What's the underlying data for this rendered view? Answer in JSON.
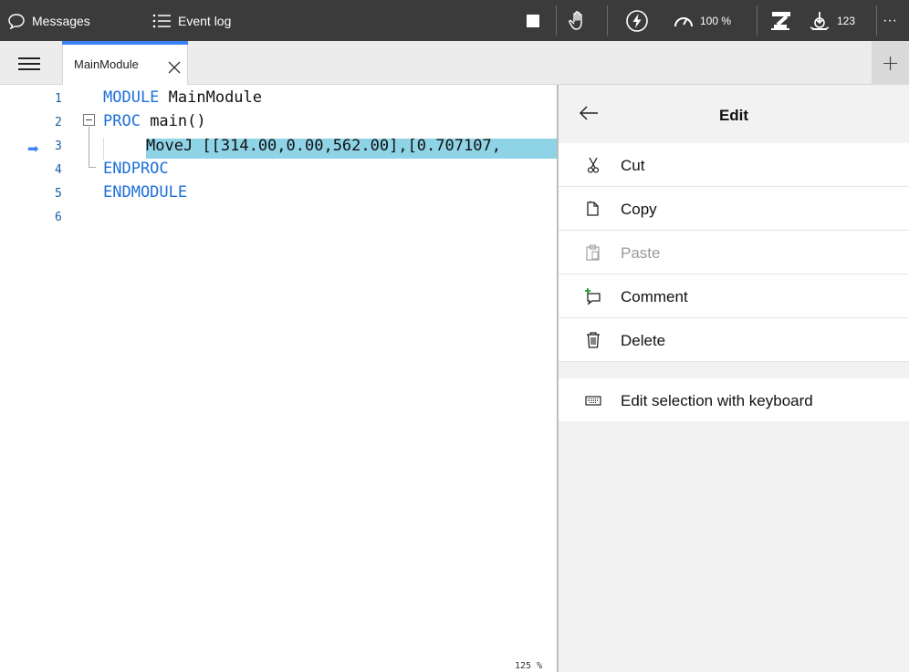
{
  "topbar": {
    "messages_label": "Messages",
    "eventlog_label": "Event log",
    "speed_label": "100 %",
    "count_label": "123",
    "more_label": "···"
  },
  "tabs": {
    "active_file": "MainModule",
    "add_label": "+"
  },
  "editor": {
    "line_numbers": [
      "1",
      "2",
      "3",
      "4",
      "5",
      "6"
    ],
    "line1_kw": "MODULE",
    "line1_name": " MainModule",
    "line2_kw": "PROC",
    "line2_rest": " main()",
    "line3_code": "MoveJ [[314.00,0.00,562.00],[0.707107,",
    "line4_kw": "ENDPROC",
    "line5_kw": "ENDMODULE",
    "zoom": "125 %",
    "pc_arrow": "➡"
  },
  "panel": {
    "title": "Edit",
    "items": [
      {
        "label": "Cut",
        "icon": "scissors-icon",
        "enabled": true
      },
      {
        "label": "Copy",
        "icon": "copy-icon",
        "enabled": true
      },
      {
        "label": "Paste",
        "icon": "paste-icon",
        "enabled": false
      },
      {
        "label": "Comment",
        "icon": "comment-icon",
        "enabled": true
      },
      {
        "label": "Delete",
        "icon": "trash-icon",
        "enabled": true
      },
      {
        "label": "Edit selection with keyboard",
        "icon": "keyboard-icon",
        "enabled": true
      }
    ]
  },
  "colors": {
    "topbar_bg": "#3b3b3b",
    "accent": "#3a82f6",
    "keyword": "#1e6fd9",
    "highlight": "#8fd3e6"
  }
}
